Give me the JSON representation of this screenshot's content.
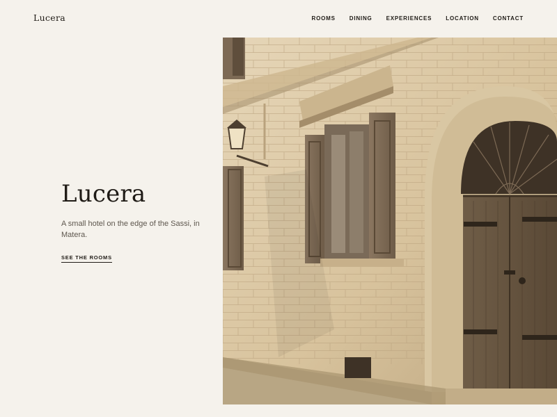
{
  "header": {
    "logo_text": "Lucera",
    "nav": [
      {
        "label": "ROOMS"
      },
      {
        "label": "DINING"
      },
      {
        "label": "EXPERIENCES"
      },
      {
        "label": "LOCATION"
      },
      {
        "label": "CONTACT"
      }
    ]
  },
  "hero": {
    "title": "Lucera",
    "subtitle": "A small hotel on the edge of the Sassi, in Matera.",
    "cta_label": "SEE THE ROOMS"
  },
  "colors": {
    "background": "#f5f2ec",
    "text": "#1f1b16",
    "muted_text": "#5e574e",
    "stone": "#dcc9a6",
    "wood": "#6b5a45"
  }
}
